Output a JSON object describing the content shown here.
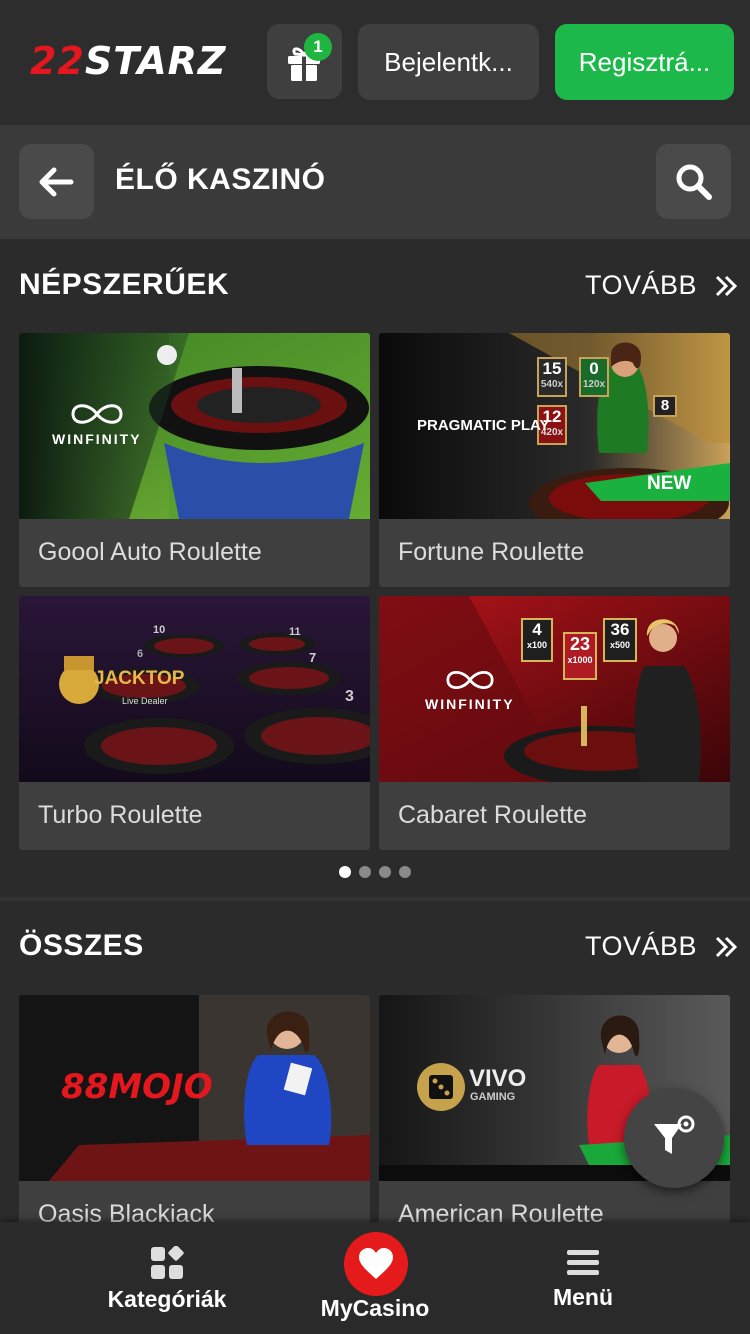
{
  "header": {
    "logo_num": "22",
    "logo_text": "STARZ",
    "gift_count": "1",
    "login_label": "Bejelentk...",
    "register_label": "Regisztrá..."
  },
  "subheader": {
    "title": "ÉLŐ KASZINÓ"
  },
  "sections": {
    "popular": {
      "title": "NÉPSZERŰEK",
      "more": "TOVÁBB",
      "games": [
        {
          "name": "Goool Auto Roulette",
          "provider": "WINFINITY"
        },
        {
          "name": "Fortune Roulette",
          "provider": "PRAGMATIC PLAY",
          "badge": "NEW"
        },
        {
          "name": "Turbo Roulette",
          "provider": "JACKTOP",
          "provider_sub": "Live Dealer"
        },
        {
          "name": "Cabaret Roulette",
          "provider": "WINFINITY"
        }
      ],
      "pager": {
        "pages": 4,
        "active": 1
      }
    },
    "all": {
      "title": "ÖSSZES",
      "more": "TOVÁBB",
      "games": [
        {
          "name": "Oasis Blackjack",
          "provider": "88MOJO"
        },
        {
          "name": "American Roulette",
          "provider": "VIVO",
          "provider_sub": "GAMING"
        }
      ]
    }
  },
  "thumb_numbers": {
    "fortune": [
      "15",
      "0",
      "12",
      "8",
      "540x",
      "120x",
      "420x"
    ],
    "cabaret": [
      "4",
      "23",
      "36",
      "x100",
      "x1000",
      "x500"
    ],
    "turbo": [
      "10",
      "11",
      "7",
      "3",
      "6"
    ]
  },
  "bottom_nav": {
    "categories": "Kategóriák",
    "mycasino": "MyCasino",
    "menu": "Menü"
  },
  "colors": {
    "accent_green": "#1db84a",
    "brand_red": "#e3171d",
    "heart_red": "#e51a1a"
  }
}
